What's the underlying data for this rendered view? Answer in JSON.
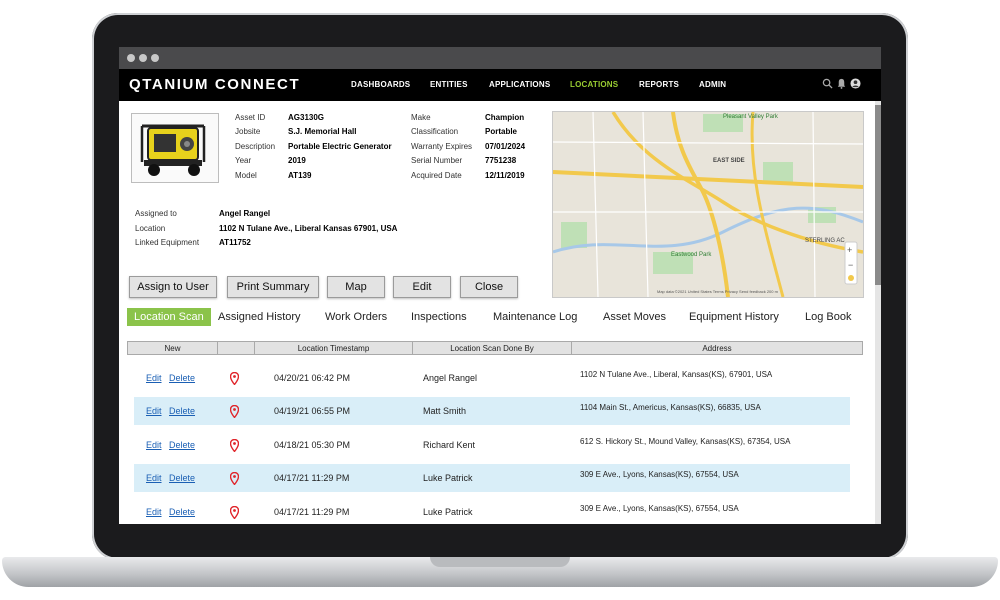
{
  "app": {
    "logo": "QTANIUM CONNECT",
    "nav": [
      {
        "label": "DASHBOARDS"
      },
      {
        "label": "ENTITIES"
      },
      {
        "label": "APPLICATIONS"
      },
      {
        "label": "LOCATIONS",
        "active": true
      },
      {
        "label": "REPORTS"
      },
      {
        "label": "ADMIN"
      }
    ],
    "header_icons": [
      "search-icon",
      "bell-icon",
      "user-icon"
    ]
  },
  "asset": {
    "left_labels": [
      "Asset ID",
      "Jobsite",
      "Description",
      "Year",
      "Model"
    ],
    "left_values": [
      "AG3130G",
      "S.J. Memorial Hall",
      "Portable Electric Generator",
      "2019",
      "AT139"
    ],
    "right_labels": [
      "Make",
      "Classification",
      "Warranty Expires",
      "Serial Number",
      "Acquired Date"
    ],
    "right_values": [
      "Champion",
      "Portable",
      "07/01/2024",
      "7751238",
      "12/11/2019"
    ],
    "assign_labels": [
      "Assigned to",
      "Location",
      "Linked Equipment"
    ],
    "assign_values": [
      "Angel Rangel",
      "1102 N Tulane Ave., Liberal Kansas 67901, USA",
      "AT11752"
    ]
  },
  "map": {
    "labels": [
      "Pleasant Valley Park",
      "EAST SIDE",
      "Eastwood Park",
      "STERLING AC"
    ],
    "footer": "Map data ©2021   United States   Terms   Privacy   Send feedback   200 m"
  },
  "buttons": [
    "Assign to User",
    "Print Summary",
    "Map",
    "Edit",
    "Close"
  ],
  "tabs": [
    "Location Scan",
    "Assigned History",
    "Work Orders",
    "Inspections",
    "Maintenance Log",
    "Asset Moves",
    "Equipment History",
    "Log Book"
  ],
  "table": {
    "headers": [
      "New",
      "",
      "Location Timestamp",
      "Location Scan Done By",
      "Address"
    ],
    "edit_label": "Edit",
    "delete_label": "Delete",
    "rows": [
      {
        "time": "04/20/21 06:42 PM",
        "by": "Angel Rangel",
        "address": "1102 N Tulane Ave., Liberal, Kansas(KS), 67901, USA"
      },
      {
        "time": "04/19/21 06:55 PM",
        "by": "Matt Smith",
        "address": "1104 Main St., Americus, Kansas(KS), 66835, USA"
      },
      {
        "time": "04/18/21 05:30 PM",
        "by": "Richard Kent",
        "address": "612 S. Hickory St., Mound Valley, Kansas(KS), 67354, USA"
      },
      {
        "time": "04/17/21 11:29 PM",
        "by": "Luke Patrick",
        "address": "309 E Ave., Lyons, Kansas(KS), 67554, USA"
      },
      {
        "time": "04/17/21 11:29 PM",
        "by": "Luke Patrick",
        "address": "309 E Ave., Lyons, Kansas(KS), 67554, USA"
      }
    ]
  },
  "colors": {
    "accent_green": "#8bc34a",
    "row_highlight": "#d9eef8",
    "pin_red": "#e0252b",
    "link_blue": "#1a5fb4"
  }
}
